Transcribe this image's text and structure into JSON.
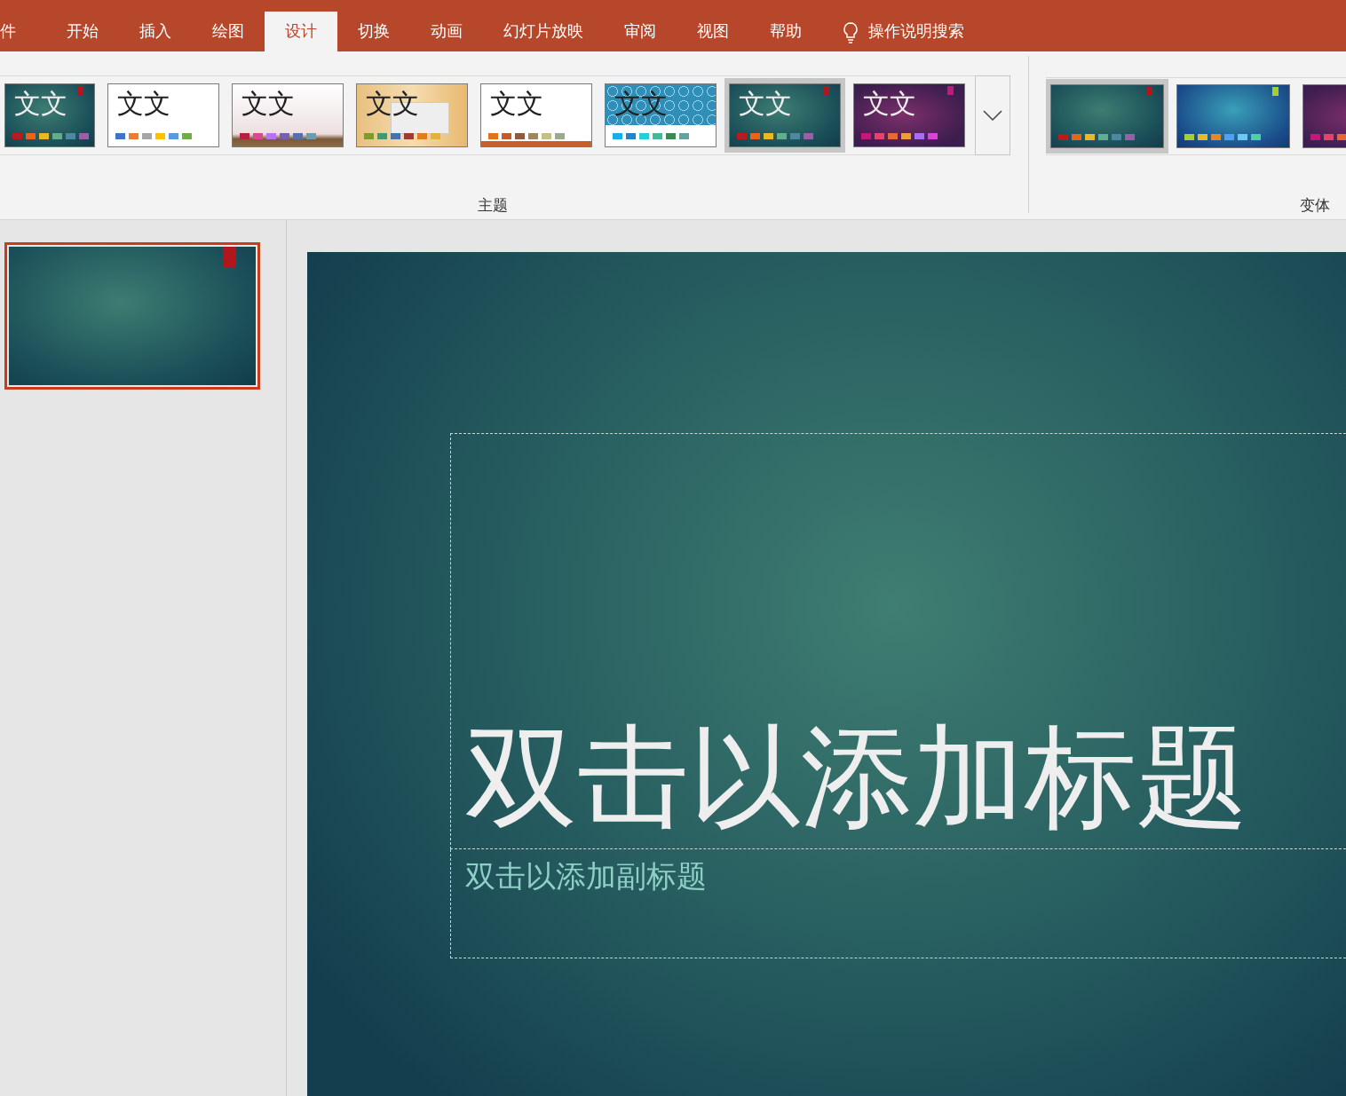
{
  "tabs": [
    {
      "label": "件",
      "selected": false
    },
    {
      "label": "开始",
      "selected": false
    },
    {
      "label": "插入",
      "selected": false
    },
    {
      "label": "绘图",
      "selected": false
    },
    {
      "label": "设计",
      "selected": true
    },
    {
      "label": "切换",
      "selected": false
    },
    {
      "label": "动画",
      "selected": false
    },
    {
      "label": "幻灯片放映",
      "selected": false
    },
    {
      "label": "审阅",
      "selected": false
    },
    {
      "label": "视图",
      "selected": false
    },
    {
      "label": "帮助",
      "selected": false
    }
  ],
  "search": {
    "label": "操作说明搜索"
  },
  "themes": {
    "label": "主题",
    "items": [
      {
        "kind": "teal",
        "text": "文文",
        "selected": false,
        "swatches": [
          {
            "color": "#b71c1c"
          },
          {
            "color": "#e8641a"
          },
          {
            "color": "#e8b829"
          },
          {
            "color": "#5fae8c"
          },
          {
            "color": "#4f87a0"
          },
          {
            "color": "#9b5ea8"
          }
        ]
      },
      {
        "kind": "white",
        "text": "文文",
        "selected": false,
        "swatches": [
          {
            "color": "#4472c4"
          },
          {
            "color": "#ed7d31"
          },
          {
            "color": "#a5a5a5"
          },
          {
            "color": "#ffc000"
          },
          {
            "color": "#5b9bd5"
          },
          {
            "color": "#70ad47"
          }
        ]
      },
      {
        "kind": "pink",
        "text": "文文",
        "selected": false,
        "swatches": [
          {
            "color": "#b71e42"
          },
          {
            "color": "#de478e"
          },
          {
            "color": "#bc72f0"
          },
          {
            "color": "#795faf"
          },
          {
            "color": "#586ea6"
          },
          {
            "color": "#6a9eaa"
          }
        ]
      },
      {
        "kind": "wood",
        "text": "文文",
        "selected": false,
        "swatches": [
          {
            "color": "#7f9a2f"
          },
          {
            "color": "#3b9b73"
          },
          {
            "color": "#4a70a6"
          },
          {
            "color": "#a23a33"
          },
          {
            "color": "#e07c1c"
          },
          {
            "color": "#e2b33a"
          }
        ]
      },
      {
        "kind": "orange",
        "text": "文文",
        "selected": false,
        "swatches": [
          {
            "color": "#e2731b"
          },
          {
            "color": "#c25c2b"
          },
          {
            "color": "#8d5b3d"
          },
          {
            "color": "#a0875a"
          },
          {
            "color": "#c6bd88"
          },
          {
            "color": "#9ca98a"
          }
        ]
      },
      {
        "kind": "pattern",
        "text": "文文",
        "selected": false,
        "swatches": [
          {
            "color": "#1cade4"
          },
          {
            "color": "#2683c6"
          },
          {
            "color": "#27ced7"
          },
          {
            "color": "#42ba97"
          },
          {
            "color": "#3e8853"
          },
          {
            "color": "#62a39f"
          }
        ]
      },
      {
        "kind": "teal",
        "text": "文文",
        "selected": true,
        "swatches": [
          {
            "color": "#b71c1c"
          },
          {
            "color": "#e8641a"
          },
          {
            "color": "#e8b829"
          },
          {
            "color": "#5fae8c"
          },
          {
            "color": "#4f87a0"
          },
          {
            "color": "#9b5ea8"
          }
        ]
      },
      {
        "kind": "purple",
        "text": "文文",
        "selected": false,
        "swatches": [
          {
            "color": "#c0197a"
          },
          {
            "color": "#e8426b"
          },
          {
            "color": "#e8673a"
          },
          {
            "color": "#ee9b3c"
          },
          {
            "color": "#a86ef0"
          },
          {
            "color": "#d844d8"
          }
        ]
      }
    ]
  },
  "variants": {
    "label": "变体",
    "items": [
      {
        "kind": "teal",
        "selected": true,
        "accent": true,
        "swatches": [
          {
            "color": "#b71c1c"
          },
          {
            "color": "#e8641a"
          },
          {
            "color": "#e8b829"
          },
          {
            "color": "#5fae8c"
          },
          {
            "color": "#4f87a0"
          },
          {
            "color": "#9b5ea8"
          }
        ]
      },
      {
        "kind": "blue",
        "selected": false,
        "accent": true,
        "swatches": [
          {
            "color": "#a6d030"
          },
          {
            "color": "#e8b829"
          },
          {
            "color": "#e8862a"
          },
          {
            "color": "#4ea2f0"
          },
          {
            "color": "#70c7f0"
          },
          {
            "color": "#4fd0a0"
          }
        ]
      },
      {
        "kind": "purple",
        "selected": false,
        "swatches": [
          {
            "color": "#c0197a"
          },
          {
            "color": "#e8426b"
          },
          {
            "color": "#e8673a"
          }
        ]
      }
    ]
  },
  "slides": [
    {
      "selected": true
    }
  ],
  "slide": {
    "title": "双击以添加标题",
    "subtitle": "双击以添加副标题"
  }
}
